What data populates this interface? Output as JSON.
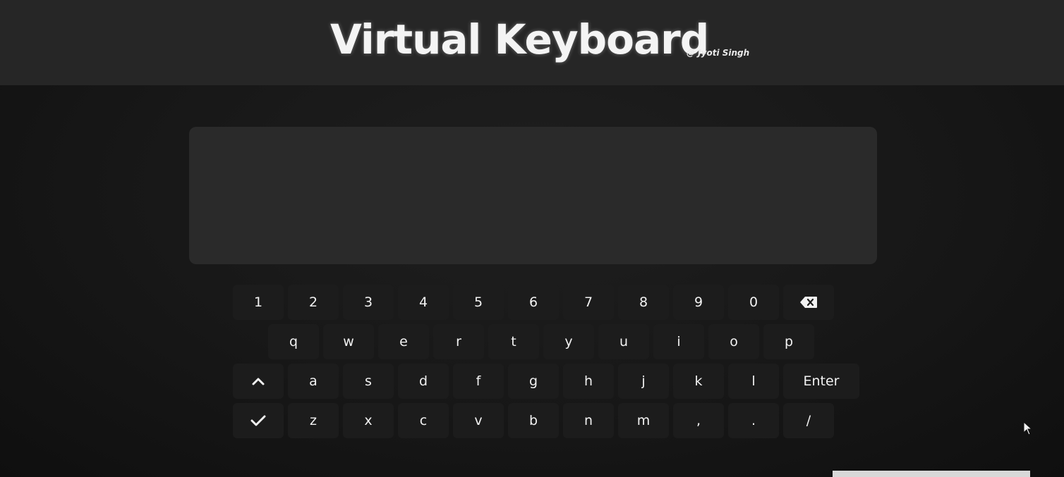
{
  "header": {
    "title": "Virtual Keyboard",
    "byline": "@ Jyoti Singh"
  },
  "textarea": {
    "value": ""
  },
  "keyboard": {
    "row1": [
      "1",
      "2",
      "3",
      "4",
      "5",
      "6",
      "7",
      "8",
      "9",
      "0"
    ],
    "backspace_icon": "backspace-icon",
    "row2": [
      "q",
      "w",
      "e",
      "r",
      "t",
      "y",
      "u",
      "i",
      "o",
      "p"
    ],
    "shift_icon": "caret-up-icon",
    "row3": [
      "a",
      "s",
      "d",
      "f",
      "g",
      "h",
      "j",
      "k",
      "l"
    ],
    "enter_label": "Enter",
    "done_icon": "checkmark-icon",
    "row4": [
      "z",
      "x",
      "c",
      "v",
      "b",
      "n",
      "m",
      ",",
      ".",
      "/"
    ]
  },
  "colors": {
    "background": "#151515",
    "header": "#262626",
    "textarea": "#2a2a2a",
    "key": "#1c1c1c",
    "text": "#f2f2f2"
  }
}
